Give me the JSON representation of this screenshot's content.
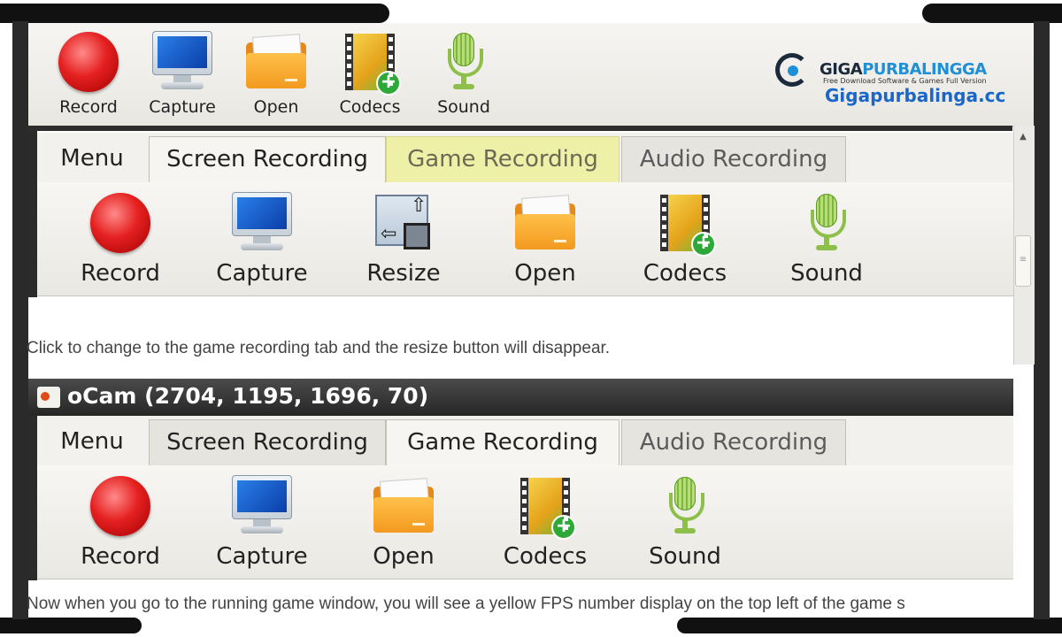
{
  "top_toolbar": {
    "buttons": [
      {
        "label": "Record",
        "icon": "record-icon"
      },
      {
        "label": "Capture",
        "icon": "monitor-icon"
      },
      {
        "label": "Open",
        "icon": "folder-icon"
      },
      {
        "label": "Codecs",
        "icon": "film-plus-icon"
      },
      {
        "label": "Sound",
        "icon": "microphone-icon"
      }
    ]
  },
  "logo": {
    "brand_part1": "GIGA",
    "brand_part2": "PURBALINGGA",
    "tagline": "Free Download Software & Games Full Version",
    "site": "Gigapurbalinga.cc"
  },
  "panel1": {
    "tabs": [
      {
        "label": "Menu"
      },
      {
        "label": "Screen Recording"
      },
      {
        "label": "Game Recording"
      },
      {
        "label": "Audio Recording"
      }
    ],
    "active_tab": "Screen Recording",
    "buttons": [
      {
        "label": "Record",
        "icon": "record-icon"
      },
      {
        "label": "Capture",
        "icon": "monitor-icon"
      },
      {
        "label": "Resize",
        "icon": "resize-icon"
      },
      {
        "label": "Open",
        "icon": "folder-icon"
      },
      {
        "label": "Codecs",
        "icon": "film-plus-icon"
      },
      {
        "label": "Sound",
        "icon": "microphone-icon"
      }
    ]
  },
  "caption1": "Click to change to the game recording tab and the resize button will disappear.",
  "window2": {
    "title": "oCam (2704, 1195, 1696, 70)"
  },
  "panel2": {
    "tabs": [
      {
        "label": "Menu"
      },
      {
        "label": "Screen Recording"
      },
      {
        "label": "Game Recording"
      },
      {
        "label": "Audio Recording"
      }
    ],
    "active_tab": "Game Recording",
    "buttons": [
      {
        "label": "Record",
        "icon": "record-icon"
      },
      {
        "label": "Capture",
        "icon": "monitor-icon"
      },
      {
        "label": "Open",
        "icon": "folder-icon"
      },
      {
        "label": "Codecs",
        "icon": "film-plus-icon"
      },
      {
        "label": "Sound",
        "icon": "microphone-icon"
      }
    ]
  },
  "caption2": "Now when you go to the running game window, you will see a yellow FPS number display on the top left of the game s",
  "colors": {
    "highlight_tab": "#eef0a8",
    "record_red": "#e52020",
    "logo_blue": "#1a66c9"
  }
}
